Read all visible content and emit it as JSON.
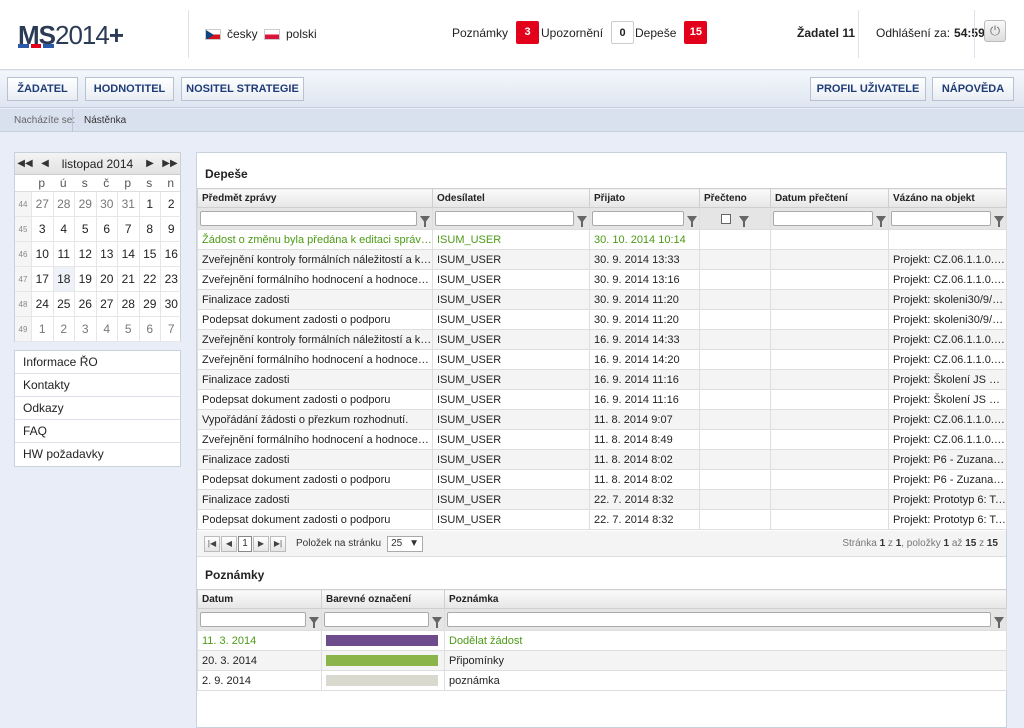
{
  "header": {
    "logo_ms": "MS",
    "logo_year": "2014",
    "logo_plus": "+",
    "languages": [
      {
        "label": "česky",
        "flag": "cz"
      },
      {
        "label": "polski",
        "flag": "pl"
      }
    ],
    "counters": [
      {
        "label": "Poznámky",
        "count": "3",
        "style": "red"
      },
      {
        "label": "Upozornění",
        "count": "0",
        "style": "white"
      },
      {
        "label": "Depeše",
        "count": "15",
        "style": "red"
      }
    ],
    "user": "Žadatel 11",
    "logout_label": "Odhlášení za:",
    "logout_time": "54:59",
    "power_icon": "power-icon"
  },
  "nav": {
    "left": [
      "ŽADATEL",
      "HODNOTITEL",
      "NOSITEL STRATEGIE"
    ],
    "right": [
      "PROFIL UŽIVATELE",
      "NÁPOVĚDA"
    ]
  },
  "breadcrumb": {
    "label": "Nacházíte se:",
    "item": "Nástěnka"
  },
  "calendar": {
    "title": "listopad 2014",
    "prev_year": "◀◀",
    "prev_month": "◀",
    "next_month": "▶",
    "next_year": "▶▶",
    "day_headers": [
      "p",
      "ú",
      "s",
      "č",
      "p",
      "s",
      "n"
    ],
    "weeks": [
      {
        "wk": "44",
        "days": [
          "27",
          "28",
          "29",
          "30",
          "31",
          "1",
          "2"
        ],
        "other": [
          true,
          true,
          true,
          true,
          true,
          false,
          false
        ]
      },
      {
        "wk": "45",
        "days": [
          "3",
          "4",
          "5",
          "6",
          "7",
          "8",
          "9"
        ],
        "other": [
          false,
          false,
          false,
          false,
          false,
          false,
          false
        ]
      },
      {
        "wk": "46",
        "days": [
          "10",
          "11",
          "12",
          "13",
          "14",
          "15",
          "16"
        ],
        "other": [
          false,
          false,
          false,
          false,
          false,
          false,
          false
        ]
      },
      {
        "wk": "47",
        "days": [
          "17",
          "18",
          "19",
          "20",
          "21",
          "22",
          "23"
        ],
        "other": [
          false,
          false,
          false,
          false,
          false,
          false,
          false
        ]
      },
      {
        "wk": "48",
        "days": [
          "24",
          "25",
          "26",
          "27",
          "28",
          "29",
          "30"
        ],
        "other": [
          false,
          false,
          false,
          false,
          false,
          false,
          false
        ]
      },
      {
        "wk": "49",
        "days": [
          "1",
          "2",
          "3",
          "4",
          "5",
          "6",
          "7"
        ],
        "other": [
          true,
          true,
          true,
          true,
          true,
          true,
          true
        ]
      }
    ],
    "today": "18"
  },
  "side_links": [
    "Informace ŘO",
    "Kontakty",
    "Odkazy",
    "FAQ",
    "HW požadavky"
  ],
  "depese": {
    "title": "Depeše",
    "columns": [
      "Předmět zprávy",
      "Odesílatel",
      "Přijato",
      "Přečteno",
      "Datum přečtení",
      "Vázáno na objekt"
    ],
    "rows": [
      {
        "subject": "Žádost o změnu byla předána k editaci správcům projektu",
        "sender": "ISUM_USER",
        "received": "30. 10. 2014 10:14",
        "read_date": "",
        "object": "",
        "unread": true
      },
      {
        "subject": "Zveřejnění kontroly formálních náležitostí a kontroly přijatelnosti",
        "sender": "ISUM_USER",
        "received": "30. 9. 2014 13:33",
        "read_date": "",
        "object": "Projekt: CZ.06.1.1.0.14_...",
        "unread": false
      },
      {
        "subject": "Zveřejnění formálního hodnocení a hodnocení přijatelnosti",
        "sender": "ISUM_USER",
        "received": "30. 9. 2014 13:16",
        "read_date": "",
        "object": "Projekt: CZ.06.1.1.0.14_...",
        "unread": false
      },
      {
        "subject": "Finalizace zadosti",
        "sender": "ISUM_USER",
        "received": "30. 9. 2014 11:20",
        "read_date": "",
        "object": "Projekt: skoleni30/9/20...",
        "unread": false
      },
      {
        "subject": "Podepsat dokument zadosti o podporu",
        "sender": "ISUM_USER",
        "received": "30. 9. 2014 11:20",
        "read_date": "",
        "object": "Projekt: skoleni30/9/20...",
        "unread": false
      },
      {
        "subject": "Zveřejnění kontroly formálních náležitostí a kontroly přijatelnosti",
        "sender": "ISUM_USER",
        "received": "16. 9. 2014 14:33",
        "read_date": "",
        "object": "Projekt: CZ.06.1.1.0.14_...",
        "unread": false
      },
      {
        "subject": "Zveřejnění formálního hodnocení a hodnocení přijatelnosti",
        "sender": "ISUM_USER",
        "received": "16. 9. 2014 14:20",
        "read_date": "",
        "object": "Projekt: CZ.06.1.1.0.14_...",
        "unread": false
      },
      {
        "subject": "Finalizace zadosti",
        "sender": "ISUM_USER",
        "received": "16. 9. 2014 11:16",
        "read_date": "",
        "object": "Projekt: Školení JS 16.9.",
        "unread": false
      },
      {
        "subject": "Podepsat dokument zadosti o podporu",
        "sender": "ISUM_USER",
        "received": "16. 9. 2014 11:16",
        "read_date": "",
        "object": "Projekt: Školení JS 16.9.",
        "unread": false
      },
      {
        "subject": "Vypořádání žádosti o přezkum rozhodnutí.",
        "sender": "ISUM_USER",
        "received": "11. 8. 2014 9:07",
        "read_date": "",
        "object": "Projekt: CZ.06.1.1.0.14_...",
        "unread": false
      },
      {
        "subject": "Zveřejnění formálního hodnocení a hodnocení přijatelnosti",
        "sender": "ISUM_USER",
        "received": "11. 8. 2014 8:49",
        "read_date": "",
        "object": "Projekt: CZ.06.1.1.0.14_...",
        "unread": false
      },
      {
        "subject": "Finalizace zadosti",
        "sender": "ISUM_USER",
        "received": "11. 8. 2014 8:02",
        "read_date": "",
        "object": "Projekt: P6 - Zuzana, 11...",
        "unread": false
      },
      {
        "subject": "Podepsat dokument zadosti o podporu",
        "sender": "ISUM_USER",
        "received": "11. 8. 2014 8:02",
        "read_date": "",
        "object": "Projekt: P6 - Zuzana, 11...",
        "unread": false
      },
      {
        "subject": "Finalizace zadosti",
        "sender": "ISUM_USER",
        "received": "22. 7. 2014 8:32",
        "read_date": "",
        "object": "Projekt: Prototyp 6: Tes...",
        "unread": false
      },
      {
        "subject": "Podepsat dokument zadosti o podporu",
        "sender": "ISUM_USER",
        "received": "22. 7. 2014 8:32",
        "read_date": "",
        "object": "Projekt: Prototyp 6: Tes...",
        "unread": false
      }
    ],
    "pager": {
      "page": "1",
      "per_page_label": "Položek na stránku",
      "per_page": "25",
      "info_pre": "Stránka",
      "page_num": "1",
      "info_of": "z",
      "page_total": "1",
      "info_items": ", položky",
      "item_from": "1",
      "info_to": "až",
      "item_to": "15",
      "info_of2": "z",
      "item_total": "15"
    }
  },
  "poznamky": {
    "title": "Poznámky",
    "columns": [
      "Datum",
      "Barevné označení",
      "Poznámka"
    ],
    "rows": [
      {
        "date": "11. 3. 2014",
        "color": "#6d4b8d",
        "note": "Dodělat žádost",
        "highlight": true
      },
      {
        "date": "20. 3. 2014",
        "color": "#8bb54a",
        "note": "Připomínky",
        "highlight": false
      },
      {
        "date": "2. 9. 2014",
        "color": "#d9d9cf",
        "note": "poznámka",
        "highlight": false
      }
    ]
  }
}
